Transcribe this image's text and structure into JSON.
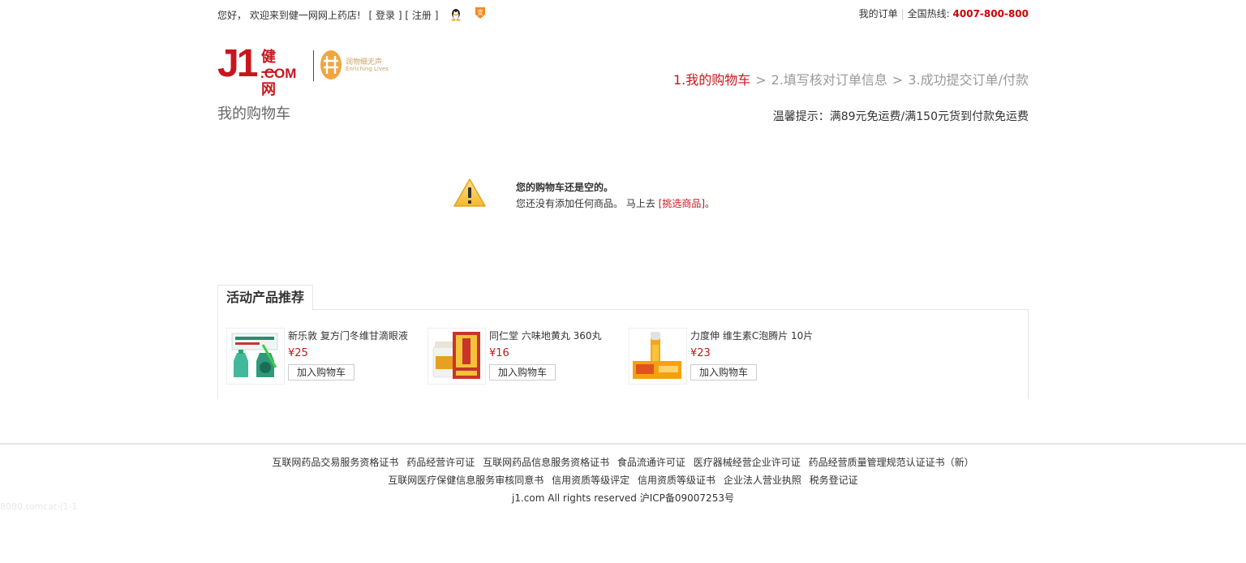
{
  "topbar": {
    "greeting": "您好， 欢迎来到健一网网上药店!",
    "login": "登录",
    "register": "注册",
    "qq_icon": "qq-penguin-icon",
    "alipay_icon": "alipay-icon",
    "my_orders": "我的订单",
    "hotline_label": "全国热线:",
    "hotline_number": "4007-800-800"
  },
  "logo": {
    "brand": "J1",
    "brand_cn": "健一网",
    "brand_com": ".COM",
    "badge_text_1": "润物细无声",
    "badge_text_2": "Enriching Lives"
  },
  "steps": {
    "step1": "1.我的购物车",
    "step2": "2.填写核对订单信息",
    "step3": "3.成功提交订单/付款",
    "separator": ">"
  },
  "cart": {
    "title": "我的购物车",
    "tip": "温馨提示：满89元免运费/满150元货到付款免运费",
    "empty_title": "您的购物车还是空的。",
    "empty_desc": "您还没有添加任何商品。 马上去",
    "empty_link": "[挑选商品]",
    "empty_end": "。"
  },
  "recommend": {
    "heading": "活动产品推荐",
    "products": [
      {
        "name": "新乐敦 复方门冬维甘滴眼液",
        "price": "¥25",
        "button": "加入购物车"
      },
      {
        "name": "同仁堂 六味地黄丸 360丸",
        "price": "¥16",
        "button": "加入购物车"
      },
      {
        "name": "力度伸 维生素C泡腾片 10片",
        "price": "¥23",
        "button": "加入购物车"
      }
    ]
  },
  "footer": {
    "line1": [
      "互联网药品交易服务资格证书",
      "药品经营许可证",
      "互联网药品信息服务资格证书",
      "食品流通许可证",
      "医疗器械经营企业许可证",
      "药品经营质量管理规范认证证书（新）"
    ],
    "line2": [
      "互联网医疗保健信息服务审核同意书",
      "信用资质等级评定",
      "信用资质等级证书",
      "企业法人营业执照",
      "税务登记证"
    ],
    "copyright": "j1.com All rights reserved 沪ICP备09007253号"
  },
  "server_tag": "8080.tomcat-j1-1",
  "colors": {
    "brand_red": "#c8161d",
    "border": "#e5e5e5",
    "muted": "#999999"
  }
}
